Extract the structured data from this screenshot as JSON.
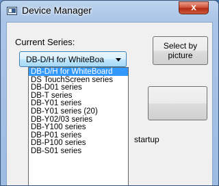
{
  "window": {
    "title": "Device Manager",
    "close_label": "x"
  },
  "main": {
    "current_series_label": "Current Series:",
    "current_series_value": "DB-D/H for WhiteBoa",
    "select_by_picture_label": "Select by picture",
    "startup_text": "startup"
  },
  "dropdown": {
    "items": [
      "DB-D/H for WhiteBoard",
      "DS TouchScreen series",
      "DB-D01 series",
      "DB-T series",
      "DB-Y01 series",
      "DB-Y01 series (20)",
      "DB-Y02/03 series",
      "DB-Y100 series",
      "DB-P01 series",
      "DB-P100 series",
      "DB-S01 series"
    ],
    "selected_index": 0
  },
  "colors": {
    "selection": "#3399ff",
    "close_button": "#c4472c"
  }
}
